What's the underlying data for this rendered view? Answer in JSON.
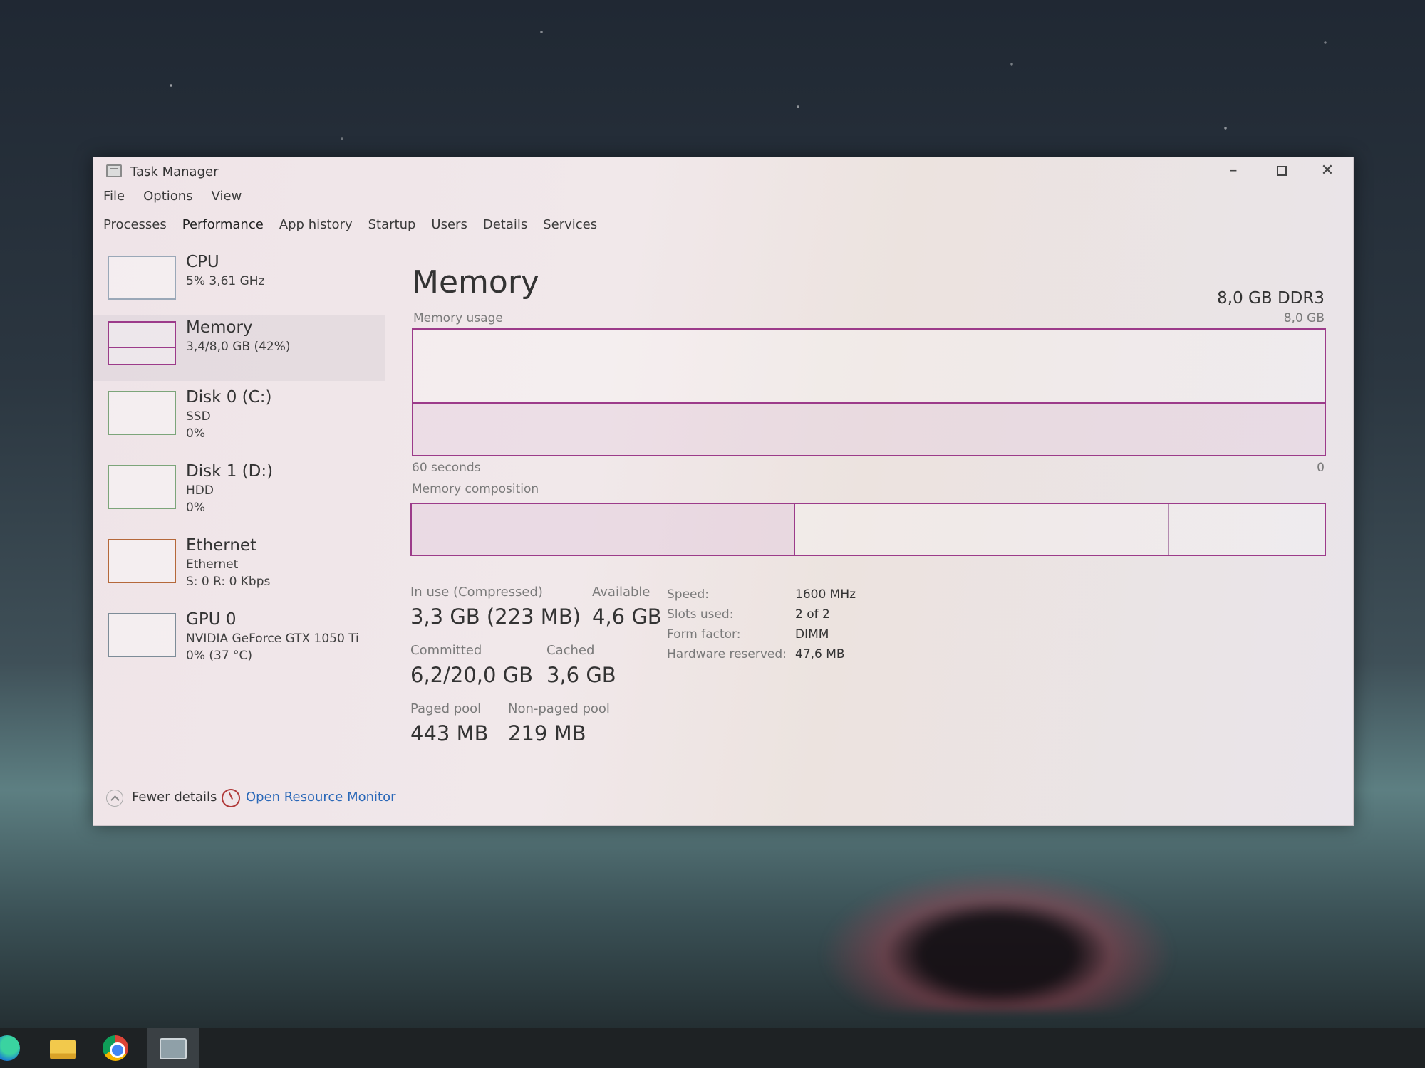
{
  "window": {
    "title": "Task Manager",
    "controls": {
      "minimize": "–",
      "maximize": "",
      "close": "✕"
    }
  },
  "menu": [
    "File",
    "Options",
    "View"
  ],
  "tabs": [
    "Processes",
    "Performance",
    "App history",
    "Startup",
    "Users",
    "Details",
    "Services"
  ],
  "active_tab": "Performance",
  "sidebar": {
    "items": [
      {
        "title": "CPU",
        "lines": [
          "5% 3,61 GHz"
        ]
      },
      {
        "title": "Memory",
        "lines": [
          "3,4/8,0 GB (42%)"
        ],
        "selected": true
      },
      {
        "title": "Disk 0 (C:)",
        "lines": [
          "SSD",
          "0%"
        ]
      },
      {
        "title": "Disk 1 (D:)",
        "lines": [
          "HDD",
          "0%"
        ]
      },
      {
        "title": "Ethernet",
        "lines": [
          "Ethernet",
          "S: 0 R: 0 Kbps"
        ]
      },
      {
        "title": "GPU 0",
        "lines": [
          "NVIDIA GeForce GTX 1050 Ti",
          "0% (37 °C)"
        ]
      }
    ]
  },
  "main": {
    "title": "Memory",
    "spec": "8,0 GB DDR3",
    "usage_label": "Memory usage",
    "usage_max": "8,0 GB",
    "time_label": "60 seconds",
    "axis_min": "0",
    "composition_label": "Memory composition",
    "usage_fraction": 0.42,
    "composition": {
      "in_use_fraction": 0.42,
      "standby_fraction": 0.83
    }
  },
  "stats": {
    "in_use_label": "In use (Compressed)",
    "in_use_value": "3,3 GB (223 MB)",
    "available_label": "Available",
    "available_value": "4,6 GB",
    "committed_label": "Committed",
    "committed_value": "6,2/20,0 GB",
    "cached_label": "Cached",
    "cached_value": "3,6 GB",
    "paged_label": "Paged pool",
    "paged_value": "443 MB",
    "nonpaged_label": "Non-paged pool",
    "nonpaged_value": "219 MB"
  },
  "specs": {
    "speed_label": "Speed:",
    "speed_value": "1600 MHz",
    "slots_label": "Slots used:",
    "slots_value": "2 of 2",
    "form_label": "Form factor:",
    "form_value": "DIMM",
    "reserved_label": "Hardware reserved:",
    "reserved_value": "47,6 MB"
  },
  "footer": {
    "fewer_details": "Fewer details",
    "resource_monitor": "Open Resource Monitor"
  },
  "colors": {
    "memory_accent": "#9c3b8a",
    "link": "#2a68b8"
  }
}
